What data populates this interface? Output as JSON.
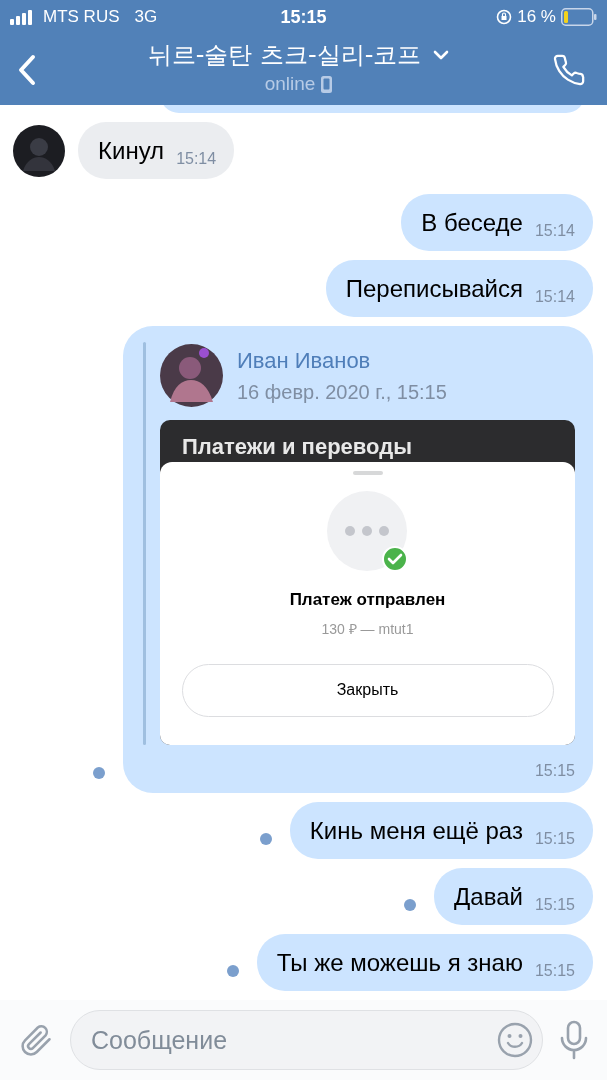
{
  "status_bar": {
    "carrier": "MTS RUS",
    "network": "3G",
    "time": "15:15",
    "battery": "16 %"
  },
  "header": {
    "title": "뉘르-술탄 츠크-실리-코프",
    "subtitle": "online"
  },
  "messages": [
    {
      "kind": "incoming",
      "text": "Кинул",
      "time": "15:14",
      "unread": false
    },
    {
      "kind": "outgoing",
      "text": "В беседе",
      "time": "15:14",
      "unread": false
    },
    {
      "kind": "outgoing",
      "text": "Переписывайся",
      "time": "15:14",
      "unread": false
    },
    {
      "kind": "forward",
      "author": "Иван Иванов",
      "date": "16 февр. 2020 г., 15:15",
      "screen_title": "Платежи и переводы",
      "status": "Платеж отправлен",
      "details": "130 ₽ — mtut1",
      "button": "Закрыть",
      "time": "15:15",
      "unread": true
    },
    {
      "kind": "outgoing",
      "text": "Кинь меня ещё раз",
      "time": "15:15",
      "unread": true
    },
    {
      "kind": "outgoing",
      "text": "Давай",
      "time": "15:15",
      "unread": true
    },
    {
      "kind": "outgoing",
      "text": "Ты же можешь я знаю",
      "time": "15:15",
      "unread": true
    }
  ],
  "composer": {
    "placeholder": "Сообщение"
  }
}
